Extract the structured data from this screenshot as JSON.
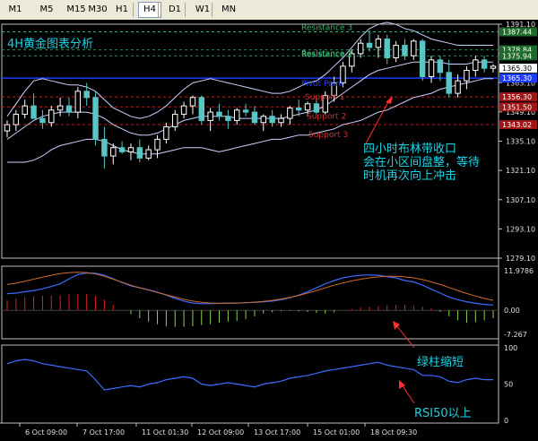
{
  "toolbar": {
    "timeframes": [
      "M1",
      "M5",
      "M15",
      "M30",
      "H1",
      "H4",
      "D1",
      "W1",
      "MN"
    ],
    "active": "H4"
  },
  "chart_title": "4H黄金图表分析",
  "levels": [
    {
      "name": "Resistance 3",
      "value": 1387.44,
      "color": "#3cb371"
    },
    {
      "name": "Resistance 2",
      "value": 1378.84,
      "color": "#2e8b57"
    },
    {
      "name": "Resistance 1",
      "value": 1375.94,
      "color": "#2e8b57"
    },
    {
      "name": "Pivot Point",
      "value": 1365.3,
      "color": "#1e3cff"
    },
    {
      "name": "Support 1",
      "value": 1356.3,
      "color": "#b22222"
    },
    {
      "name": "Support 2",
      "value": 1351.5,
      "color": "#b22222"
    },
    {
      "name": "Support 3",
      "value": 1343.02,
      "color": "#b22222"
    }
  ],
  "price_axis": {
    "ticks": [
      "1391.10",
      "1377.10",
      "1363.10",
      "1349.10",
      "1335.10",
      "1321.10",
      "1307.10",
      "1293.10",
      "1279.10"
    ],
    "current": "1365.30",
    "marker_color": "#ffffff"
  },
  "macd_axis": {
    "ticks": [
      "11.9786",
      "0.00",
      "-7.267"
    ]
  },
  "rsi_axis": {
    "ticks": [
      "100",
      "50",
      "0"
    ]
  },
  "time_axis": {
    "labels": [
      "6 Oct 09:00",
      "7 Oct 17:00",
      "11 Oct 01:30",
      "12 Oct 09:00",
      "13 Oct 17:00",
      "15 Oct 01:00",
      "18 Oct 09:30"
    ]
  },
  "annotations": {
    "bollinger_note": [
      "四小时布林带收口",
      "会在小区间盘整，等待",
      "时机再次向上冲击"
    ],
    "macd_note": "绿柱缩短",
    "rsi_note": "RSI50以上"
  },
  "chart_data": {
    "type": "candlestick",
    "title": "4H黄金图表分析",
    "ylim": [
      1279.1,
      1391.1
    ],
    "x": [
      "6 Oct 09:00",
      "7 Oct 17:00",
      "11 Oct 01:30",
      "12 Oct 09:00",
      "13 Oct 17:00",
      "15 Oct 01:00",
      "18 Oct 09:30"
    ],
    "ohlc": [
      [
        1340,
        1345,
        1337,
        1343
      ],
      [
        1343,
        1350,
        1340,
        1348
      ],
      [
        1348,
        1355,
        1346,
        1352
      ],
      [
        1352,
        1358,
        1348,
        1346
      ],
      [
        1346,
        1350,
        1341,
        1344
      ],
      [
        1344,
        1352,
        1342,
        1350
      ],
      [
        1350,
        1356,
        1347,
        1352
      ],
      [
        1352,
        1356,
        1347,
        1349
      ],
      [
        1349,
        1361,
        1346,
        1359
      ],
      [
        1359,
        1363,
        1352,
        1356
      ],
      [
        1356,
        1359,
        1333,
        1336
      ],
      [
        1336,
        1342,
        1322,
        1328
      ],
      [
        1328,
        1334,
        1324,
        1332
      ],
      [
        1332,
        1335,
        1329,
        1330
      ],
      [
        1330,
        1334,
        1326,
        1332
      ],
      [
        1332,
        1336,
        1325,
        1327
      ],
      [
        1327,
        1333,
        1326,
        1331
      ],
      [
        1331,
        1338,
        1327,
        1336
      ],
      [
        1336,
        1344,
        1334,
        1342
      ],
      [
        1342,
        1350,
        1340,
        1348
      ],
      [
        1348,
        1354,
        1346,
        1352
      ],
      [
        1352,
        1357,
        1348,
        1356
      ],
      [
        1356,
        1357,
        1343,
        1345
      ],
      [
        1345,
        1351,
        1340,
        1349
      ],
      [
        1349,
        1353,
        1345,
        1347
      ],
      [
        1347,
        1350,
        1341,
        1345
      ],
      [
        1345,
        1351,
        1343,
        1350
      ],
      [
        1350,
        1353,
        1347,
        1349
      ],
      [
        1349,
        1352,
        1343,
        1344
      ],
      [
        1344,
        1348,
        1340,
        1347
      ],
      [
        1347,
        1350,
        1342,
        1344
      ],
      [
        1344,
        1348,
        1342,
        1346
      ],
      [
        1346,
        1352,
        1343,
        1351
      ],
      [
        1351,
        1355,
        1347,
        1350
      ],
      [
        1350,
        1354,
        1347,
        1353
      ],
      [
        1353,
        1356,
        1348,
        1349
      ],
      [
        1349,
        1359,
        1348,
        1357
      ],
      [
        1357,
        1366,
        1354,
        1363
      ],
      [
        1363,
        1373,
        1361,
        1371
      ],
      [
        1371,
        1379,
        1368,
        1377
      ],
      [
        1377,
        1384,
        1375,
        1382
      ],
      [
        1382,
        1388,
        1378,
        1380
      ],
      [
        1380,
        1386,
        1375,
        1384
      ],
      [
        1384,
        1386,
        1372,
        1375
      ],
      [
        1375,
        1383,
        1373,
        1381
      ],
      [
        1381,
        1384,
        1374,
        1376
      ],
      [
        1376,
        1384,
        1374,
        1383
      ],
      [
        1383,
        1384,
        1364,
        1366
      ],
      [
        1366,
        1376,
        1363,
        1374
      ],
      [
        1374,
        1376,
        1364,
        1368
      ],
      [
        1368,
        1374,
        1356,
        1358
      ],
      [
        1358,
        1367,
        1356,
        1364
      ],
      [
        1364,
        1371,
        1360,
        1369
      ],
      [
        1369,
        1376,
        1366,
        1374
      ],
      [
        1374,
        1376,
        1368,
        1370
      ],
      [
        1370,
        1372,
        1368,
        1371
      ]
    ],
    "bollinger": {
      "upper": [
        1347,
        1353,
        1359,
        1364,
        1365,
        1364,
        1363,
        1362,
        1362,
        1361,
        1359,
        1355,
        1351,
        1349,
        1347,
        1346,
        1347,
        1349,
        1352,
        1356,
        1360,
        1363,
        1364,
        1365,
        1364,
        1363,
        1362,
        1361,
        1360,
        1359,
        1358,
        1358,
        1359,
        1361,
        1363,
        1364,
        1367,
        1371,
        1375,
        1380,
        1385,
        1389,
        1391,
        1392,
        1391,
        1389,
        1388,
        1386,
        1384,
        1383,
        1382,
        1381,
        1381,
        1381,
        1381,
        1381
      ],
      "middle": [
        1336,
        1339,
        1342,
        1345,
        1347,
        1348,
        1349,
        1349,
        1349,
        1349,
        1348,
        1346,
        1343,
        1341,
        1339,
        1338,
        1338,
        1339,
        1341,
        1343,
        1345,
        1346,
        1347,
        1347,
        1347,
        1347,
        1346,
        1346,
        1346,
        1346,
        1346,
        1346,
        1347,
        1348,
        1349,
        1350,
        1352,
        1355,
        1358,
        1361,
        1364,
        1367,
        1369,
        1370,
        1371,
        1372,
        1373,
        1373,
        1373,
        1373,
        1372,
        1372,
        1372,
        1373,
        1373,
        1373
      ],
      "lower": [
        1325,
        1325,
        1325,
        1326,
        1328,
        1331,
        1333,
        1334,
        1335,
        1336,
        1336,
        1335,
        1333,
        1331,
        1330,
        1329,
        1329,
        1329,
        1330,
        1331,
        1332,
        1332,
        1332,
        1331,
        1330,
        1331,
        1332,
        1333,
        1334,
        1335,
        1336,
        1336,
        1337,
        1338,
        1338,
        1339,
        1340,
        1341,
        1343,
        1344,
        1345,
        1347,
        1349,
        1350,
        1352,
        1354,
        1356,
        1357,
        1358,
        1360,
        1361,
        1362,
        1363,
        1364,
        1365,
        1365
      ]
    },
    "macd": {
      "ylim": [
        -7.267,
        11.9786
      ],
      "histogram": [
        3,
        3.6,
        4,
        4.2,
        4.4,
        4.4,
        4.5,
        4.8,
        5,
        5,
        4.4,
        3.2,
        1.6,
        0.2,
        -1.2,
        -2.4,
        -3.4,
        -4.2,
        -4.8,
        -5,
        -5,
        -4.8,
        -4.5,
        -4.2,
        -3.8,
        -3.4,
        -3.2,
        -2.6,
        -1.8,
        -1.0,
        -0.6,
        -0.3,
        -0.2,
        -0.3,
        -0.5,
        -0.8,
        -1.0,
        -0.6,
        0,
        0.4,
        0.8,
        1.1,
        1.3,
        1.5,
        1.6,
        1.6,
        1.5,
        1.1,
        0.6,
        -0.5,
        -1.8,
        -3.0,
        -3.8,
        -3.6,
        -3.0,
        -2.4
      ],
      "main": [
        5,
        5.2,
        5.6,
        6,
        6.5,
        7.2,
        8,
        9.5,
        10.8,
        11.3,
        11.2,
        10.6,
        9.5,
        8.4,
        7.4,
        6.8,
        6.2,
        5.5,
        4.6,
        3.6,
        2.8,
        2.2,
        2.0,
        2.0,
        2.1,
        2.2,
        2.2,
        2.3,
        2.4,
        2.6,
        2.8,
        3.2,
        3.8,
        4.6,
        5.6,
        6.8,
        8,
        9,
        9.8,
        10.3,
        10.6,
        10.7,
        10.6,
        10.2,
        9.8,
        9.0,
        8.6,
        7.6,
        6.4,
        5.2,
        4.0,
        3.2,
        2.6,
        2.1,
        1.8,
        1.6
      ],
      "signal": [
        7.8,
        8.2,
        8.8,
        9.4,
        10,
        10.6,
        11.1,
        11.4,
        11.5,
        11.4,
        11.0,
        10.3,
        9.4,
        8.5,
        7.6,
        6.8,
        6.1,
        5.4,
        4.7,
        4.0,
        3.3,
        2.8,
        2.4,
        2.2,
        2.1,
        2.1,
        2.2,
        2.3,
        2.5,
        2.7,
        3.0,
        3.4,
        3.9,
        4.5,
        5.2,
        6.0,
        6.8,
        7.6,
        8.3,
        8.9,
        9.4,
        9.8,
        10.1,
        10.3,
        10.3,
        10.1,
        9.8,
        9.3,
        8.6,
        7.8,
        6.9,
        6.0,
        5.1,
        4.3,
        3.6,
        3.0
      ]
    },
    "rsi": {
      "ylim": [
        0,
        100
      ],
      "values": [
        78,
        82,
        84,
        82,
        78,
        76,
        74,
        72,
        70,
        68,
        56,
        42,
        44,
        46,
        48,
        46,
        50,
        52,
        56,
        58,
        60,
        58,
        50,
        48,
        50,
        52,
        50,
        48,
        46,
        50,
        52,
        54,
        58,
        60,
        62,
        65,
        68,
        70,
        72,
        74,
        76,
        78,
        80,
        76,
        74,
        72,
        70,
        62,
        62,
        60,
        54,
        52,
        56,
        58,
        56,
        56
      ]
    }
  }
}
